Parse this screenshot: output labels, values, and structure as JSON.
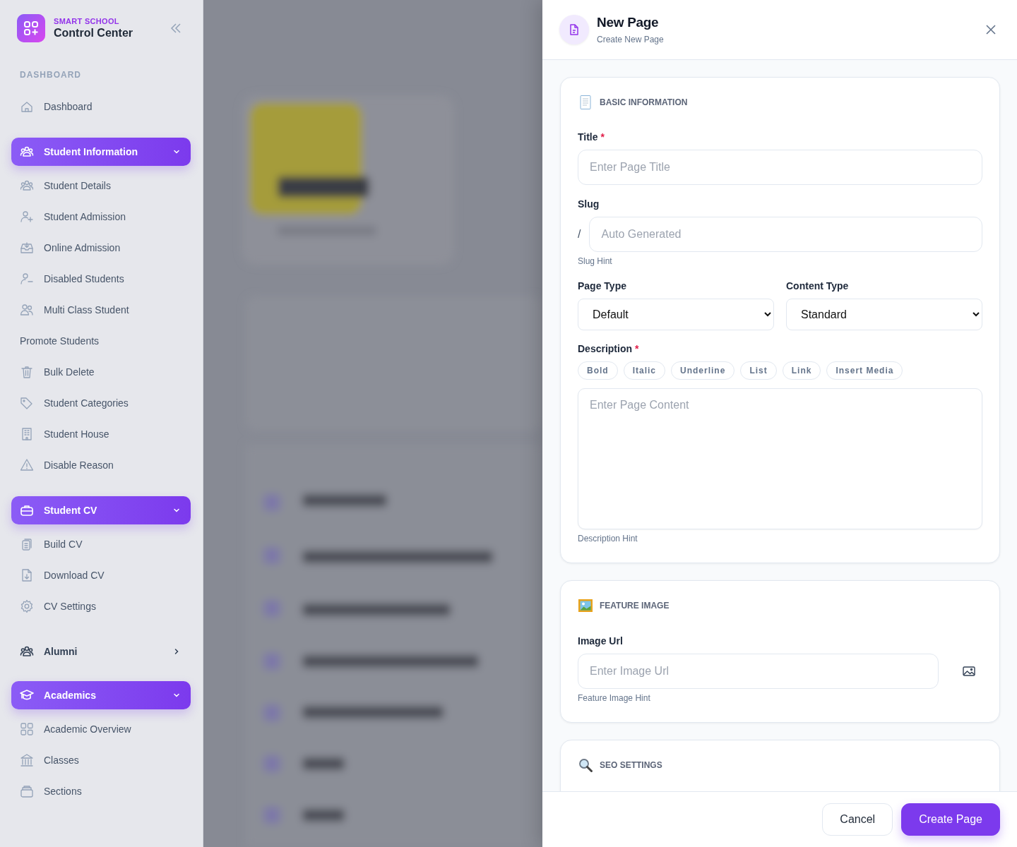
{
  "sidebar": {
    "brand": {
      "eyebrow": "SMART SCHOOL",
      "title": "Control Center"
    },
    "nav": [
      {
        "kind": "heading",
        "label": "DASHBOARD"
      },
      {
        "kind": "link",
        "label": "Dashboard"
      },
      {
        "kind": "group",
        "label": "Student Information",
        "expanded": true,
        "children": [
          {
            "label": "Student Details"
          },
          {
            "label": "Student Admission"
          },
          {
            "label": "Online Admission"
          },
          {
            "label": "Disabled Students"
          },
          {
            "label": "Multi Class Student"
          },
          {
            "label": "Promote Students"
          },
          {
            "label": "Bulk Delete"
          },
          {
            "label": "Student Categories"
          },
          {
            "label": "Student House"
          },
          {
            "label": "Disable Reason"
          }
        ]
      },
      {
        "kind": "group",
        "label": "Student CV",
        "expanded": true,
        "children": [
          {
            "label": "Build CV"
          },
          {
            "label": "Download CV"
          },
          {
            "label": "CV Settings"
          }
        ]
      },
      {
        "kind": "group",
        "label": "Alumni",
        "expanded": false
      },
      {
        "kind": "group",
        "label": "Academics",
        "expanded": true,
        "children": [
          {
            "label": "Academic Overview"
          },
          {
            "label": "Classes"
          },
          {
            "label": "Sections"
          }
        ]
      }
    ]
  },
  "drawer": {
    "title": "New Page",
    "subtitle": "Create New Page",
    "sections": [
      {
        "heading": "BASIC INFORMATION",
        "fields": [
          {
            "kind": "text",
            "label": "Title",
            "required_mark": "*",
            "placeholder": "Enter Page Title"
          },
          {
            "kind": "slug",
            "label": "Slug",
            "prefix": "/",
            "placeholder": "Auto Generated",
            "hint": "Slug Hint"
          },
          {
            "kind": "selects",
            "items": [
              {
                "label": "Page Type",
                "value": "Default"
              },
              {
                "label": "Content Type",
                "value": "Standard"
              }
            ]
          },
          {
            "kind": "richtext",
            "label": "Description",
            "required_mark": "*",
            "toolbar": [
              "Bold",
              "Italic",
              "Underline",
              "List",
              "Link",
              "Insert Media"
            ],
            "placeholder": "Enter Page Content",
            "hint": "Description Hint"
          }
        ]
      },
      {
        "heading": "FEATURE IMAGE",
        "fields": [
          {
            "kind": "image",
            "label": "Image Url",
            "placeholder": "Enter Image Url",
            "hint": "Feature Image Hint"
          }
        ]
      },
      {
        "heading": "SEO SETTINGS"
      }
    ],
    "buttons": [
      {
        "label": "Cancel",
        "kind": "secondary"
      },
      {
        "label": "Create Page",
        "kind": "primary"
      }
    ]
  }
}
